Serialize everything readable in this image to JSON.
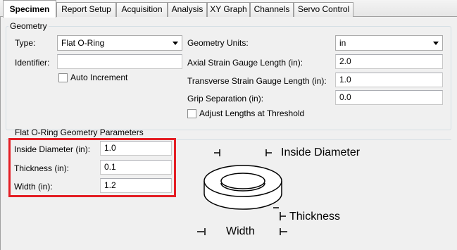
{
  "tabs": [
    {
      "label": "Specimen",
      "active": true
    },
    {
      "label": "Report Setup",
      "active": false
    },
    {
      "label": "Acquisition",
      "active": false
    },
    {
      "label": "Analysis",
      "active": false
    },
    {
      "label": "XY Graph",
      "active": false
    },
    {
      "label": "Channels",
      "active": false
    },
    {
      "label": "Servo Control",
      "active": false
    }
  ],
  "geometry": {
    "title": "Geometry",
    "type_label": "Type:",
    "type_value": "Flat O-Ring",
    "identifier_label": "Identifier:",
    "identifier_value": "",
    "auto_increment_label": "Auto Increment",
    "auto_increment_checked": false,
    "units_label": "Geometry Units:",
    "units_value": "in",
    "axial_label": "Axial Strain Gauge Length (in):",
    "axial_value": "2.0",
    "transverse_label": "Transverse Strain Gauge Length (in):",
    "transverse_value": "1.0",
    "grip_label": "Grip Separation (in):",
    "grip_value": "0.0",
    "adjust_label": "Adjust Lengths at Threshold",
    "adjust_checked": false
  },
  "params": {
    "title": "Flat O-Ring Geometry Parameters",
    "inside_diameter_label": "Inside Diameter (in):",
    "inside_diameter_value": "1.0",
    "thickness_label": "Thickness (in):",
    "thickness_value": "0.1",
    "width_label": "Width (in):",
    "width_value": "1.2"
  },
  "diagram": {
    "inside_diameter": "Inside Diameter",
    "thickness": "Thickness",
    "width": "Width"
  },
  "colors": {
    "highlight": "#e41e24",
    "panel": "#f0f0f0"
  }
}
